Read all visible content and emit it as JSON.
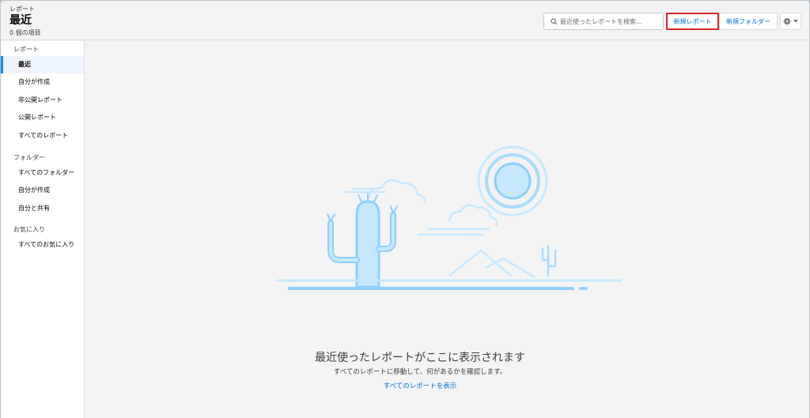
{
  "header": {
    "eyebrow": "レポート",
    "title": "最近",
    "count": "0 個の項目",
    "search_placeholder": "最近使ったレポートを検索...",
    "new_report": "新規レポート",
    "new_folder": "新規フォルダー",
    "settings_icon": "gear-icon"
  },
  "sidebar": {
    "sections": [
      {
        "title": "レポート",
        "items": [
          "最近",
          "自分が作成",
          "非公開レポート",
          "公開レポート",
          "すべてのレポート"
        ]
      },
      {
        "title": "フォルダー",
        "items": [
          "すべてのフォルダー",
          "自分が作成",
          "自分と共有"
        ]
      },
      {
        "title": "お気に入り",
        "items": [
          "すべてのお気に入り"
        ]
      }
    ],
    "active": "最近"
  },
  "empty_state": {
    "title": "最近使ったレポートがここに表示されます",
    "description": "すべてのレポートに移動して、何があるかを確認します。",
    "link": "すべてのレポートを表示"
  },
  "colors": {
    "accent": "#0070d2",
    "highlight": "#e0262a",
    "illustration": "#8ed0fb"
  }
}
